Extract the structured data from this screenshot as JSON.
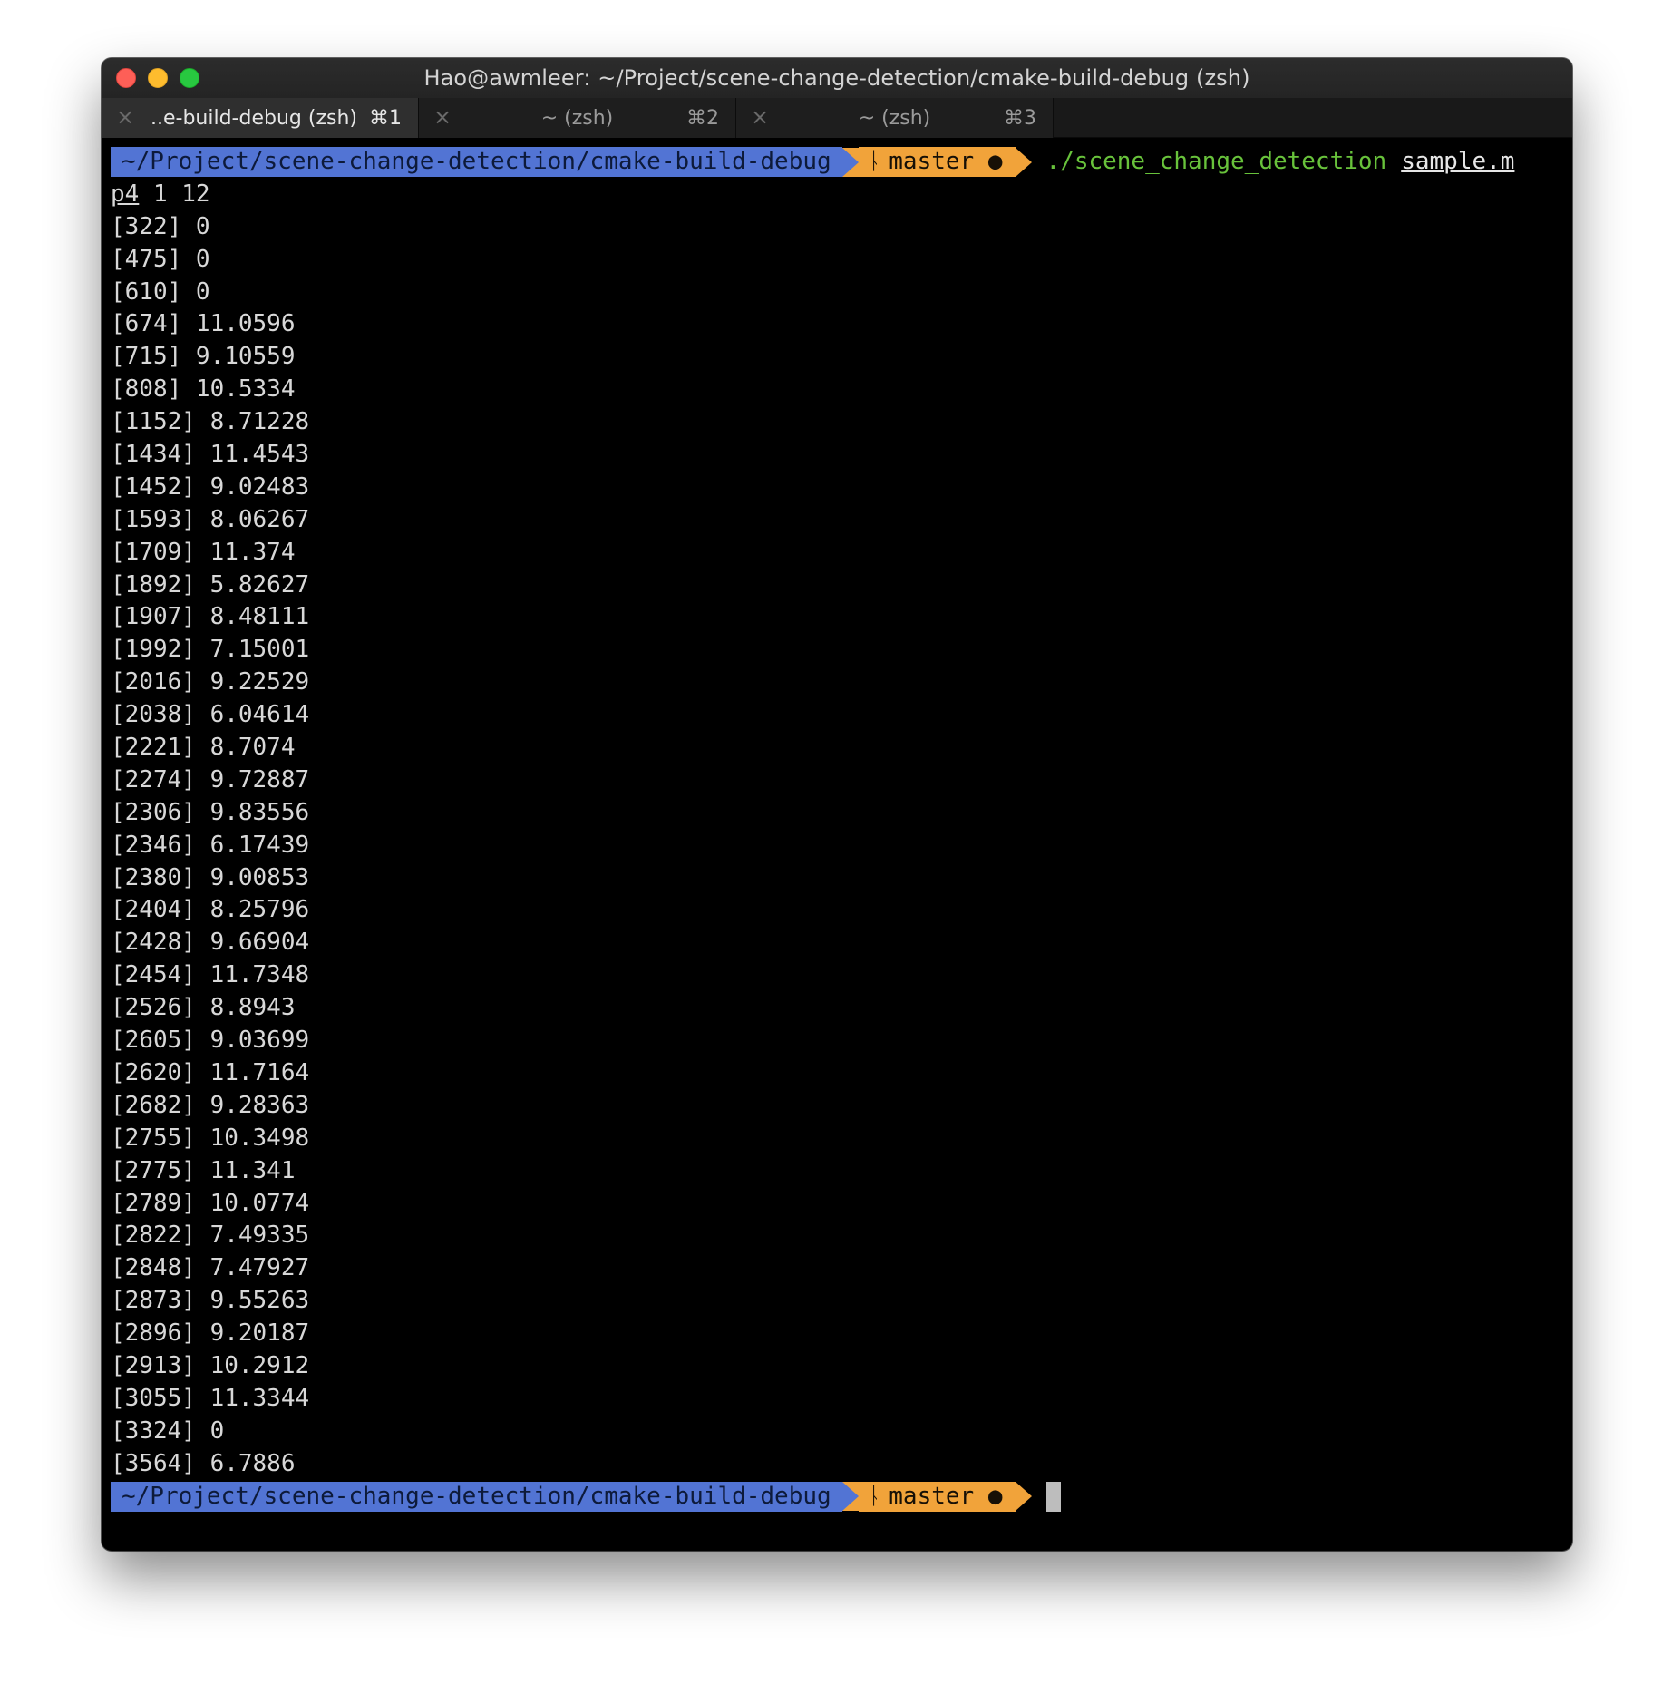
{
  "window": {
    "title": "Hao@awmleer: ~/Project/scene-change-detection/cmake-build-debug (zsh)"
  },
  "tabs": [
    {
      "label": "..e-build-debug (zsh)",
      "shortcut": "⌘1",
      "active": true
    },
    {
      "label": "~ (zsh)",
      "shortcut": "⌘2",
      "active": false
    },
    {
      "label": "~ (zsh)",
      "shortcut": "⌘3",
      "active": false
    }
  ],
  "icons": {
    "close_tab": "×",
    "branch": "ᚿ",
    "dirty": "●"
  },
  "prompt": {
    "path": "~/Project/scene-change-detection/cmake-build-debug",
    "branch": "master",
    "command": "./scene_change_detection",
    "arg": "sample.m"
  },
  "first_line": {
    "wrap": "p4",
    "rest": " 1 12"
  },
  "output": [
    "[322] 0",
    "[475] 0",
    "[610] 0",
    "[674] 11.0596",
    "[715] 9.10559",
    "[808] 10.5334",
    "[1152] 8.71228",
    "[1434] 11.4543",
    "[1452] 9.02483",
    "[1593] 8.06267",
    "[1709] 11.374",
    "[1892] 5.82627",
    "[1907] 8.48111",
    "[1992] 7.15001",
    "[2016] 9.22529",
    "[2038] 6.04614",
    "[2221] 8.7074",
    "[2274] 9.72887",
    "[2306] 9.83556",
    "[2346] 6.17439",
    "[2380] 9.00853",
    "[2404] 8.25796",
    "[2428] 9.66904",
    "[2454] 11.7348",
    "[2526] 8.8943",
    "[2605] 9.03699",
    "[2620] 11.7164",
    "[2682] 9.28363",
    "[2755] 10.3498",
    "[2775] 11.341",
    "[2789] 10.0774",
    "[2822] 7.49335",
    "[2848] 7.47927",
    "[2873] 9.55263",
    "[2896] 9.20187",
    "[2913] 10.2912",
    "[3055] 11.3344",
    "[3324] 0",
    "[3564] 6.7886"
  ]
}
